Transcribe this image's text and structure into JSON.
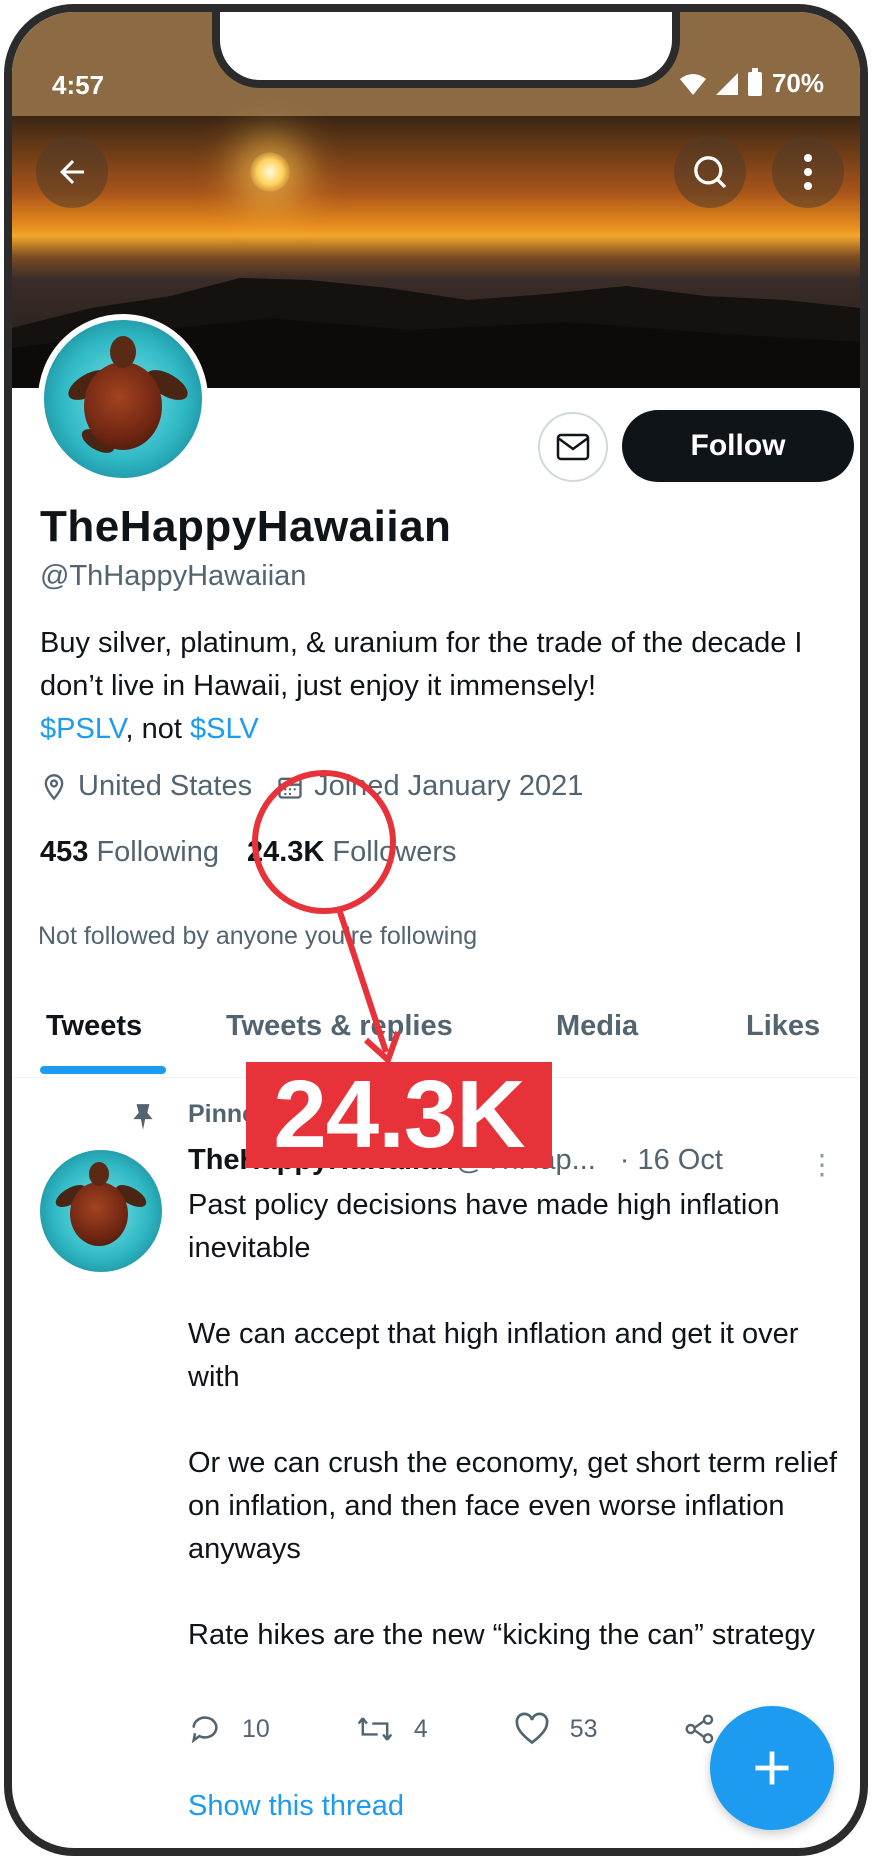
{
  "status_bar": {
    "time": "4:57",
    "battery": "70%"
  },
  "profile": {
    "name": "TheHappyHawaiian",
    "handle": "@ThHappyHawaiian",
    "bio_line1": "Buy silver, platinum, & uranium for the trade of the decade  I don’t live in Hawaii, just enjoy it immensely!",
    "bio_link1": "$PSLV",
    "bio_middle": ", not ",
    "bio_link2": "$SLV",
    "location": "United States",
    "joined": "Joined January 2021",
    "following_count": "453",
    "following_label": "Following",
    "followers_count": "24.3K",
    "followers_label": "Followers",
    "not_followed": "Not followed by anyone you’re following",
    "follow_label": "Follow"
  },
  "tabs": [
    "Tweets",
    "Tweets & replies",
    "Media",
    "Likes"
  ],
  "tweet": {
    "pinned_label": "Pinned Tweet",
    "name": "TheHappyHawaiian",
    "handle": "@ThHap...",
    "date": "· 16 Oct",
    "body": "Past policy decisions have made high inflation inevitable\n\nWe can accept that high inflation and get it over with\n\nOr we can crush the economy, get short term relief on inflation, and then face even worse inflation anyways\n\nRate hikes are the new “kicking the can” strategy",
    "replies": "10",
    "retweets": "4",
    "likes": "53",
    "show_thread": "Show this thread"
  },
  "annotation": {
    "label": "24.3K",
    "color": "#e8323a"
  },
  "colors": {
    "accent": "#1d9bf0",
    "status_bar": "#8c6b44",
    "text": "#0f1419",
    "muted": "#536471"
  }
}
